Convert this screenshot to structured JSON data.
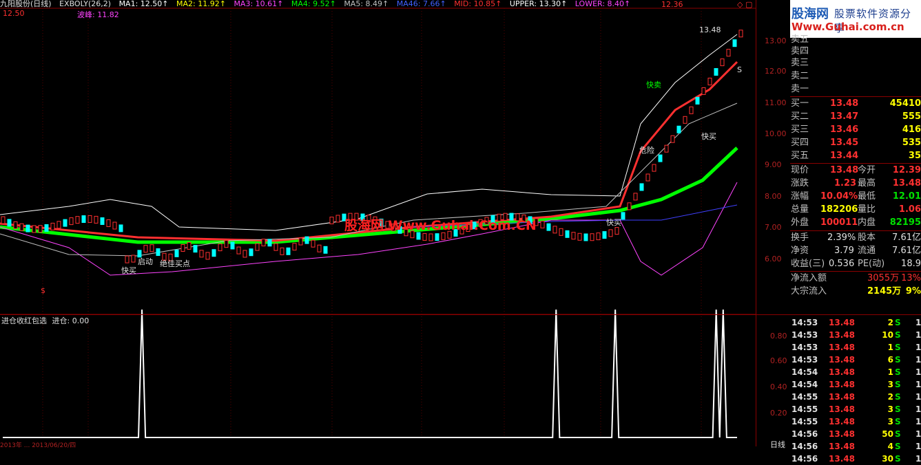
{
  "header": {
    "stock": "九阳股份(日线)",
    "indicator": "EXBOLY(26,2)",
    "ma1": "MA1: 12.50↑",
    "ma2": "MA2: 11.92↑",
    "ma3": "MA3: 10.61↑",
    "ma4": "MA4: 9.52↑",
    "ma5": "MA5: 8.49↑",
    "ma46": "MA46: 7.66↑",
    "mid": "MID: 10.85↑",
    "upper": "UPPER: 13.30↑",
    "lower": "LOWER: 8.40↑",
    "price_marker_right": "12.36",
    "price_marker_left": "12.50",
    "wave_label": "波峰: 11.82"
  },
  "colors": {
    "ma1": "#ffffff",
    "ma2": "#ffff00",
    "ma3": "#ff44ff",
    "ma4": "#00ff00",
    "ma5": "#c0c0c0",
    "ma46": "#4040ff",
    "mid": "#ff3030",
    "upper": "#ffffff",
    "lower": "#ff3030"
  },
  "price_axis": [
    "13.00",
    "12.00",
    "11.00",
    "10.00",
    "9.00",
    "8.00",
    "7.00",
    "6.00"
  ],
  "sub_axis": [
    "0.80",
    "0.60",
    "0.40",
    "0.20"
  ],
  "chart_labels": {
    "high_mark": "13.48",
    "quick_buy_1": "快买",
    "quick_buy_2": "快买",
    "quick_buy_3": "快买",
    "start": "启动",
    "best_buy": "绝佳买点",
    "danger": "危险",
    "quick_sell": "快卖",
    "s_mark": "S",
    "dollar": "$"
  },
  "watermark": "股海网 Www.Guhai.Com.CN",
  "sub_indicator": {
    "title": "进仓收红包选",
    "value": "进仓: 0.00"
  },
  "signals": [
    0,
    0,
    0,
    0,
    0,
    0,
    0,
    0,
    0,
    0,
    0,
    0,
    0,
    0,
    0,
    0,
    0,
    0,
    0,
    0,
    0,
    0,
    0,
    0,
    0,
    0,
    0,
    0,
    0,
    0,
    0,
    0,
    0,
    0,
    0,
    0,
    0,
    0,
    0,
    0,
    1,
    0,
    0,
    0,
    0,
    0,
    0,
    0,
    0,
    0,
    0,
    0,
    0,
    0,
    0,
    0,
    0,
    0,
    0,
    0,
    0,
    0,
    0,
    0,
    0,
    0,
    0,
    0,
    0,
    0,
    0,
    0,
    0,
    0,
    0,
    0,
    0,
    0,
    0,
    0,
    0,
    0,
    0,
    0,
    0,
    0,
    0,
    0,
    0,
    0,
    0,
    0,
    0,
    0,
    0,
    0,
    0,
    0,
    0,
    0,
    0,
    0,
    0,
    0,
    0,
    0,
    0,
    0,
    0,
    0,
    0,
    0,
    0,
    0,
    0,
    0,
    0,
    0,
    0,
    0,
    0,
    0,
    0,
    0,
    0,
    0,
    0,
    0,
    0,
    0,
    0,
    0,
    0,
    0,
    0,
    0,
    0,
    0,
    0,
    0,
    0,
    0,
    0,
    0,
    0,
    0,
    0,
    0,
    0,
    0,
    0,
    0,
    0,
    0,
    0,
    0,
    0,
    0,
    0,
    1,
    0,
    0,
    0,
    0,
    0,
    0,
    0,
    0,
    0,
    0,
    0,
    0,
    0,
    0,
    0,
    0,
    1,
    0,
    0,
    0,
    0,
    0,
    0,
    0,
    0,
    0,
    0,
    0,
    0,
    0,
    0,
    0,
    0,
    0,
    0,
    0,
    0,
    0,
    0,
    0,
    0,
    0,
    0,
    0,
    0,
    1,
    0,
    1,
    0,
    0,
    0,
    0
  ],
  "date_strip": "2013年  ...  2013/06/20/四",
  "logo": {
    "name": "股海网",
    "slogan": "股票软件资源分享",
    "url": "Www.Guhai.com.cn"
  },
  "order_book": {
    "sell": [
      "卖五",
      "卖四",
      "卖三",
      "卖二",
      "卖一"
    ],
    "buy": [
      {
        "label": "买一",
        "price": "13.48",
        "vol": "45410"
      },
      {
        "label": "买二",
        "price": "13.47",
        "vol": "555"
      },
      {
        "label": "买三",
        "price": "13.46",
        "vol": "416"
      },
      {
        "label": "买四",
        "price": "13.45",
        "vol": "535"
      },
      {
        "label": "买五",
        "price": "13.44",
        "vol": "35"
      }
    ]
  },
  "quote": [
    {
      "l1": "现价",
      "v1": "13.48",
      "l2": "今开",
      "v2": "12.39"
    },
    {
      "l1": "涨跌",
      "v1": "1.23",
      "l2": "最高",
      "v2": "13.48"
    },
    {
      "l1": "涨幅",
      "v1": "10.04%",
      "l2": "最低",
      "v2": "12.01"
    },
    {
      "l1": "总量",
      "v1": "182206",
      "l2": "量比",
      "v2": "1.06"
    },
    {
      "l1": "外盘",
      "v1": "100011",
      "l2": "内盘",
      "v2": "82195"
    }
  ],
  "fundamentals": [
    {
      "l1": "换手",
      "v1": "2.39%",
      "l2": "股本",
      "v2": "7.61亿"
    },
    {
      "l1": "净资",
      "v1": "3.79",
      "l2": "流通",
      "v2": "7.61亿"
    },
    {
      "l1": "收益(三)",
      "v1": "0.536",
      "l2": "PE(动)",
      "v2": "18.9"
    }
  ],
  "flows": [
    {
      "label": "净流入额",
      "value": "3055万",
      "pct": "13%"
    },
    {
      "label": "大宗流入",
      "value": "2145万",
      "pct": "9%"
    }
  ],
  "ticks": [
    {
      "time": "14:53",
      "price": "13.48",
      "vol": "2",
      "side": "S",
      "n": "1"
    },
    {
      "time": "14:53",
      "price": "13.48",
      "vol": "10",
      "side": "S",
      "n": "1"
    },
    {
      "time": "14:53",
      "price": "13.48",
      "vol": "1",
      "side": "S",
      "n": "1"
    },
    {
      "time": "14:53",
      "price": "13.48",
      "vol": "6",
      "side": "S",
      "n": "1"
    },
    {
      "time": "14:54",
      "price": "13.48",
      "vol": "1",
      "side": "S",
      "n": "1"
    },
    {
      "time": "14:54",
      "price": "13.48",
      "vol": "3",
      "side": "S",
      "n": "1"
    },
    {
      "time": "14:55",
      "price": "13.48",
      "vol": "2",
      "side": "S",
      "n": "1"
    },
    {
      "time": "14:55",
      "price": "13.48",
      "vol": "3",
      "side": "S",
      "n": "1"
    },
    {
      "time": "14:55",
      "price": "13.48",
      "vol": "3",
      "side": "S",
      "n": "1"
    },
    {
      "time": "14:56",
      "price": "13.48",
      "vol": "50",
      "side": "S",
      "n": "1"
    },
    {
      "time": "14:56",
      "price": "13.48",
      "vol": "4",
      "side": "S",
      "n": "1"
    },
    {
      "time": "14:56",
      "price": "13.48",
      "vol": "30",
      "side": "S",
      "n": "1"
    }
  ],
  "period_label": "日线"
}
